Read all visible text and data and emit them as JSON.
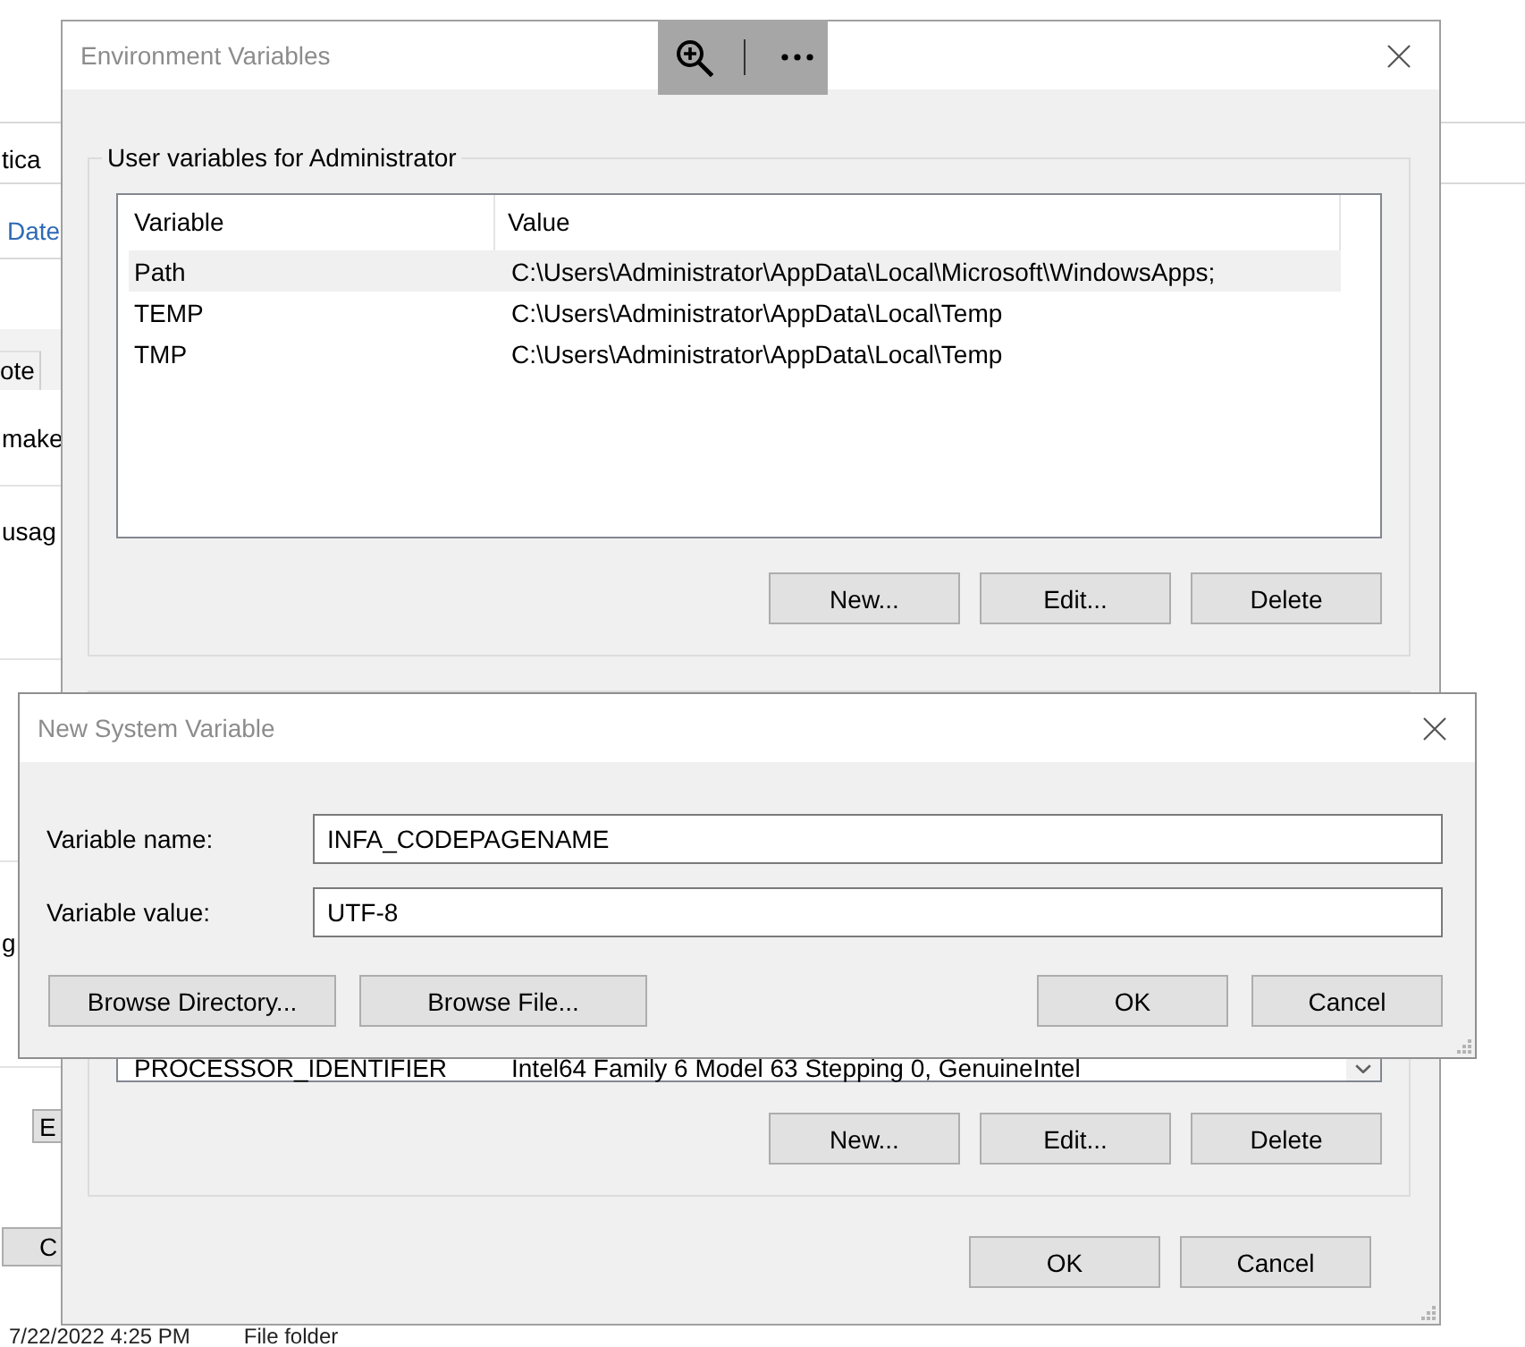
{
  "background_window": {
    "address_text": "tica",
    "tab": "Date",
    "column_header": "ote",
    "cells": [
      "make",
      "usag",
      "g"
    ],
    "buttons": [
      "E",
      "C"
    ],
    "file_row": [
      "7/22/2022 4:25 PM",
      "File folder"
    ]
  },
  "environment_variables_window": {
    "title": "Environment Variables",
    "user_variables": {
      "title": "User variables for Administrator",
      "columns": [
        "Variable",
        "Value"
      ],
      "rows": [
        {
          "variable": "Path",
          "value": "C:\\Users\\Administrator\\AppData\\Local\\Microsoft\\WindowsApps;",
          "selected": true
        },
        {
          "variable": "TEMP",
          "value": "C:\\Users\\Administrator\\AppData\\Local\\Temp",
          "selected": false
        },
        {
          "variable": "TMP",
          "value": "C:\\Users\\Administrator\\AppData\\Local\\Temp",
          "selected": false
        }
      ],
      "buttons": [
        "New...",
        "Edit...",
        "Delete"
      ]
    },
    "system_variables": {
      "rows": [
        {
          "variable": "PROCESSOR_IDENTIFIER",
          "value": "Intel64 Family 6 Model 63 Stepping 0, GenuineIntel",
          "selected": false
        }
      ],
      "buttons": [
        "New...",
        "Edit...",
        "Delete"
      ]
    },
    "buttons": [
      "OK",
      "Cancel"
    ]
  },
  "new_system_variable_dialog": {
    "title": "New System Variable",
    "fields": [
      {
        "label": "Variable name:",
        "value": "INFA_CODEPAGENAME"
      },
      {
        "label": "Variable value:",
        "value": "UTF-8"
      }
    ],
    "browse_buttons": [
      "Browse Directory...",
      "Browse File..."
    ],
    "buttons": [
      "OK",
      "Cancel"
    ]
  }
}
